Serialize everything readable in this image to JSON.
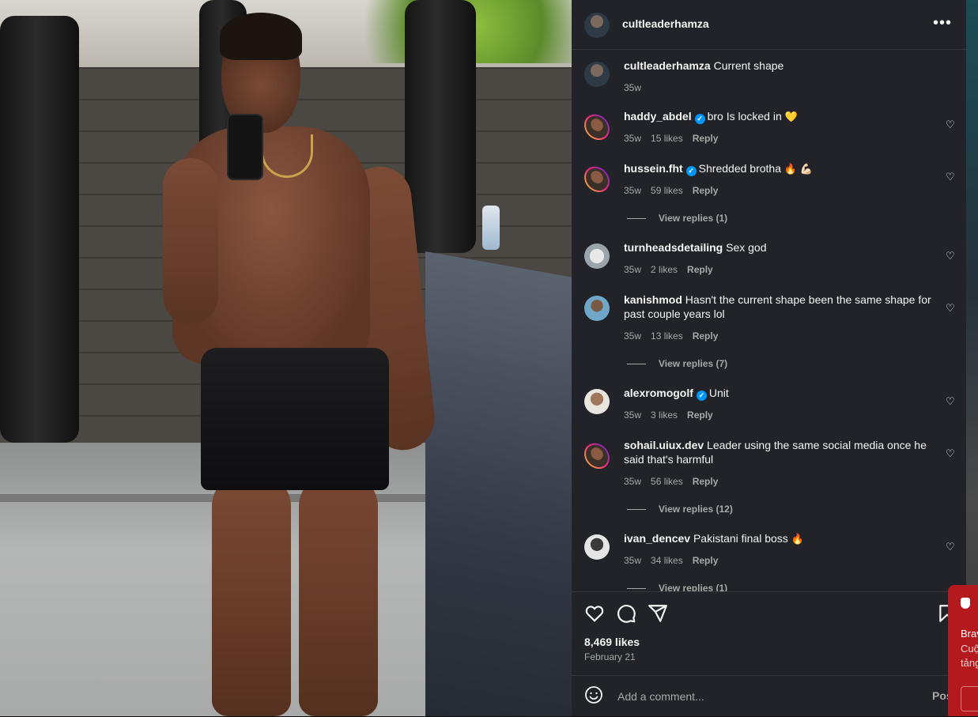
{
  "post": {
    "author": "cultleaderhamza",
    "caption": "Current shape",
    "caption_time": "35w",
    "more_icon": "more-horizontal-icon",
    "likes": "8,469 likes",
    "date": "February 21"
  },
  "comments": [
    {
      "user": "haddy_abdel",
      "verified": true,
      "text": "bro Is locked in",
      "emoji": "💛",
      "time": "35w",
      "likes": "15 likes",
      "reply": "Reply"
    },
    {
      "user": "hussein.fht",
      "verified": true,
      "text": "Shredded brotha",
      "emoji": "🔥 💪🏻",
      "time": "35w",
      "likes": "59 likes",
      "reply": "Reply",
      "view_replies": "View replies (1)"
    },
    {
      "user": "turnheadsdetailing",
      "verified": false,
      "text": "Sex god",
      "emoji": "",
      "time": "35w",
      "likes": "2 likes",
      "reply": "Reply"
    },
    {
      "user": "kanishmod",
      "verified": false,
      "text": "Hasn't the current shape been the same shape for past couple years lol",
      "emoji": "",
      "time": "35w",
      "likes": "13 likes",
      "reply": "Reply",
      "view_replies": "View replies (7)"
    },
    {
      "user": "alexromogolf",
      "verified": true,
      "text": "Unit",
      "emoji": "",
      "time": "35w",
      "likes": "3 likes",
      "reply": "Reply"
    },
    {
      "user": "sohail.uiux.dev",
      "verified": false,
      "text": "Leader using the same social media once he said that's harmful",
      "emoji": "",
      "time": "35w",
      "likes": "56 likes",
      "reply": "Reply",
      "view_replies": "View replies (12)"
    },
    {
      "user": "ivan_dencev",
      "verified": false,
      "text": "Pakistani final boss",
      "emoji": "🔥",
      "time": "35w",
      "likes": "34 likes",
      "reply": "Reply",
      "view_replies": "View replies (1)"
    }
  ],
  "composer": {
    "placeholder": "Add a comment...",
    "post_label": "Pos"
  },
  "popup": {
    "line1": "Brav",
    "line2": "Cuộ",
    "line3": "tảng"
  },
  "colors": {
    "panel_bg": "#212328",
    "verified": "#0095f6",
    "muted_text": "#a8a8a8",
    "popup_bg": "#b3191d"
  }
}
